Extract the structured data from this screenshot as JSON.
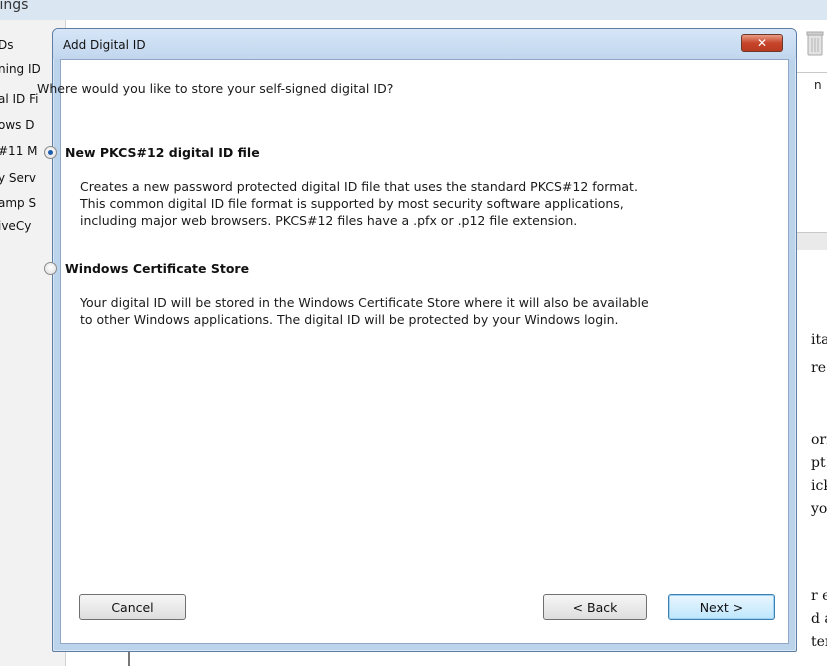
{
  "background": {
    "title_fragment": "tings",
    "sidebar_items": [
      "Ds",
      "ning ID",
      "al ID Fi",
      "ows D",
      "#11 M",
      "y Serv",
      "amp S",
      "iveCy"
    ],
    "right_panel_header": "n",
    "doc_text_fragments": [
      "ital I",
      "re or",
      "orm",
      "pt o",
      "ick",
      "you",
      "r en",
      "d ad",
      "ter i"
    ]
  },
  "dialog": {
    "title": "Add Digital ID",
    "close_glyph": "✕",
    "question": "Where would you like to store your self-signed digital ID?",
    "options": [
      {
        "label": "New PKCS#12 digital ID file",
        "selected": true,
        "description_lines": [
          "Creates a new password protected digital ID file that uses the standard PKCS#12 format.",
          "This common digital ID file format is supported by most security software applications,",
          "including major web browsers. PKCS#12 files have a .pfx or .p12 file extension."
        ]
      },
      {
        "label": "Windows Certificate Store",
        "selected": false,
        "description_lines": [
          "Your digital ID will be stored in the Windows Certificate Store where it will also be available",
          "to other Windows applications. The digital ID will be protected by your Windows login."
        ]
      }
    ],
    "buttons": {
      "cancel": "Cancel",
      "back": "< Back",
      "next": "Next >"
    }
  },
  "colors": {
    "dialog_frame": "#bcd3ec",
    "close_button": "#c7452b",
    "radio_selected": "#1f5fae"
  }
}
